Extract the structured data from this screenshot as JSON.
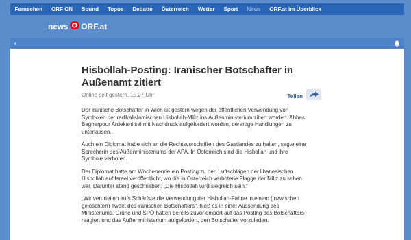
{
  "topnav": {
    "items": [
      {
        "label": "Fernsehen"
      },
      {
        "label": "ORF ON"
      },
      {
        "label": "Sound"
      },
      {
        "label": "Topos"
      },
      {
        "label": "Debatte"
      },
      {
        "label": "Österreich"
      },
      {
        "label": "Wetter"
      },
      {
        "label": "Sport"
      },
      {
        "label": "News"
      },
      {
        "label": "ORF.at im Überblick"
      }
    ]
  },
  "logo": {
    "news": "news",
    "orf": "ORF.at"
  },
  "panel_bar": {
    "back_glyph": "‹",
    "bell_icon": "bell-icon"
  },
  "article": {
    "headline": "Hisbollah-Posting: Iranischer Botschafter in Außenamt zitiert",
    "meta": "Online seit gestern, 15.27 Uhr",
    "share_label": "Teilen",
    "paragraphs": [
      "Der iranische Botschafter in Wien ist gestern wegen der öffentlichen Verwendung von Symbolen der radikalislamischen Hisbollah-Miliz ins Außenministerium zitiert worden. Abbas Bagherpour Ardekani sei mit Nachdruck aufgefordert worden, derartige Handlungen zu unterlassen.",
      "Auch ein Diplomat habe sich an die Rechtsvorschriften des Gastlandes zu halten, sagte eine Sprecherin des Außenministeriums der APA. In Österreich sind die Hisbollah und ihre Symbole verboten.",
      "Der Diplomat hatte am Wochenende ein Posting zu den Luftschlägen der libanesischen Hisbollah auf Israel veröffentlicht, wo die in Österreich verbotene Flagge der Miliz zu sehen war. Darunter stand geschrieben: „Die Hisbollah wird siegreich sein.“",
      "„Wir verurteilen aufs Schärfste die Verwendung der Hisbollah-Fahne in einem (inzwischen gelöschten) Tweet des iranischen Botschafters“, hieß es in einer Aussendung des Ministeriums. Grüne und SPÖ hatten bereits zuvor empört auf das Posting des Botschafters reagiert und das Außenministerium aufgefordert, den Botschafter vorzuladen."
    ]
  },
  "colors": {
    "background": "#5b8ccb",
    "topnav": "#2966b8",
    "panel_bar": "#4e83c9",
    "accent_red": "#e3000f",
    "link": "#2e5f9e"
  }
}
